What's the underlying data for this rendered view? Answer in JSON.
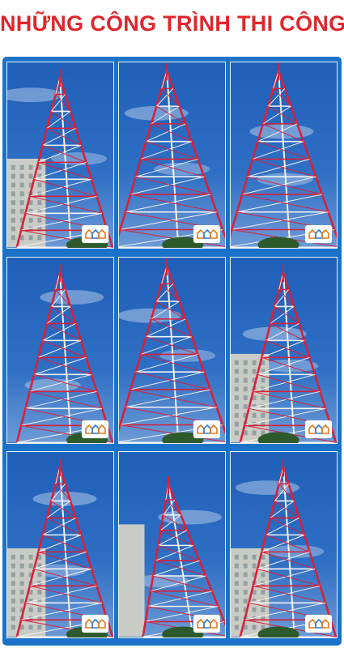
{
  "title": "NHỮNG CÔNG TRÌNH THI CÔNG",
  "colors": {
    "title": "#e0262b",
    "panel": "#1a73c8",
    "sky": "#2f6fc4",
    "tower_red": "#d8203a",
    "tower_white": "#f2f2f2",
    "building": "#c9ccc6"
  },
  "photos": [
    {
      "subject": "tower-with-building-left"
    },
    {
      "subject": "tower-base-closeup"
    },
    {
      "subject": "tower-base-closeup"
    },
    {
      "subject": "tower-full-view"
    },
    {
      "subject": "tower-base-closeup"
    },
    {
      "subject": "tower-with-building-left"
    },
    {
      "subject": "tower-with-building-left"
    },
    {
      "subject": "tower-tilted-view"
    },
    {
      "subject": "tower-with-building-left"
    }
  ],
  "logo_icon": "company-logo-icon"
}
